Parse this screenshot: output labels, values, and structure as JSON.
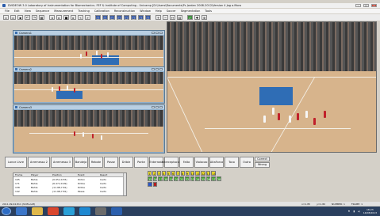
{
  "window": {
    "title": "DVIDEOW 3.0  Laboratory of Instrumentation for Biomechanics- FEF & Institute of Computing - Unicamp [D:\\Users\\Documents\\Pc Jordan 2008-2012\\Version 4 Jog a.Moro"
  },
  "menu": [
    "File",
    "Edit",
    "View",
    "Sequence",
    "Measurement",
    "Tracking",
    "Calibration",
    "Reconstruction",
    "Window",
    "Help",
    "Soccer",
    "Segmentation",
    "Tools"
  ],
  "toolbar": {
    "icons": [
      "new-icon",
      "open-icon",
      "save-icon",
      "undo-icon",
      "redo-icon",
      "grid-icon",
      "prev-frame-icon",
      "play-icon",
      "stop-icon",
      "next-frame-icon",
      "rewind-icon",
      "fast-forward-icon",
      "layout-icon",
      "layout2-icon",
      "layout3-icon",
      "layout4-icon",
      "layout5-icon",
      "layout6-icon",
      "layout7-icon",
      "layout8-icon",
      "zoom-in-icon",
      "zoom-out-icon",
      "measure-icon",
      "chart-icon",
      "track-icon",
      "marker-icon",
      "crosshair-icon"
    ]
  },
  "cameras": [
    {
      "label": "Camera1"
    },
    {
      "label": "Camera2"
    },
    {
      "label": "Camera3"
    }
  ],
  "event_buttons": [
    "Lance Livre",
    "Arremesso 2",
    "Arremesso 3",
    "Bandeja",
    "Rebote",
    "Passe",
    "Drible",
    "Ponte",
    "Enterrada",
    "Interceptacao",
    "Falta",
    "Violacao",
    "AltaForca",
    "Toco",
    "Outro"
  ],
  "correct_wrong": [
    "Correct",
    "Wrong"
  ],
  "event_table": {
    "headers": [
      "Frame",
      "Player",
      "Position",
      "Event",
      "Result"
    ],
    "rows": [
      [
        "195",
        "Bahia",
        "(0.95,10.55)",
        "Dirbin",
        "Certo"
      ],
      [
        "171",
        "Bahia",
        "(6.47,10.99)",
        "Drible",
        "Certo"
      ],
      [
        "158",
        "Bahia",
        "(11.98,7.81)",
        "Drible",
        "Certo"
      ],
      [
        "142",
        "Bahia",
        "(11.98,7.81)",
        "Passe",
        "Certo"
      ]
    ]
  },
  "player_numbers": {
    "row1": [
      "1",
      "2",
      "3",
      "4",
      "5",
      "6",
      "7",
      "8",
      "9",
      "10",
      "11",
      "12",
      "13",
      "14"
    ],
    "row2": [
      "15",
      "16",
      "17",
      "18",
      "19",
      "20",
      "21",
      "22",
      "23",
      "24",
      "25",
      "26",
      "27",
      "28"
    ],
    "row3": [
      "",
      ""
    ]
  },
  "status": {
    "left": "2011.09.04.811 (Shift+left)",
    "x": "x=1.85",
    "y": "y=1.80",
    "number": "NUMBER: 1",
    "frame": "FRAME: 1"
  },
  "taskbar": {
    "clock_time": "18:23",
    "clock_date": "14/08/2013"
  },
  "colors": {
    "yellow_button": "#f4e12a",
    "green_button": "#3f9c2e",
    "blue_button": "#2b56c6",
    "red_button": "#b61e1e"
  }
}
